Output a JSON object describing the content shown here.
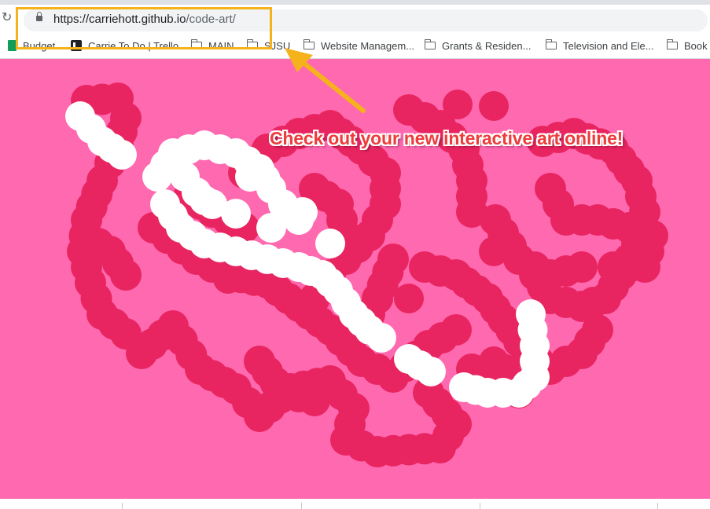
{
  "browser": {
    "url_host": "https://carriehott.github.io",
    "url_path": "/code-art/"
  },
  "bookmarks": [
    {
      "label": "Budget",
      "icon": "google-sheets-icon"
    },
    {
      "label": "Carrie To Do | Trello",
      "icon": "trello-icon"
    },
    {
      "label": "MAIN",
      "icon": "folder-icon"
    },
    {
      "label": "SJSU",
      "icon": "folder-icon"
    },
    {
      "label": "Website Managem...",
      "icon": "folder-icon"
    },
    {
      "label": "Grants & Residen...",
      "icon": "folder-icon"
    },
    {
      "label": "Television and Ele...",
      "icon": "folder-icon"
    },
    {
      "label": "Book",
      "icon": "folder-icon"
    }
  ],
  "annotation": {
    "caption": "Check out your new interactive art online!",
    "highlight_color": "#f6b21b",
    "caption_color": "#ee3b3b"
  },
  "art": {
    "background_color": "#ff69b0",
    "dot_color_primary": "#e82560",
    "dot_color_secondary": "#ffffff"
  }
}
